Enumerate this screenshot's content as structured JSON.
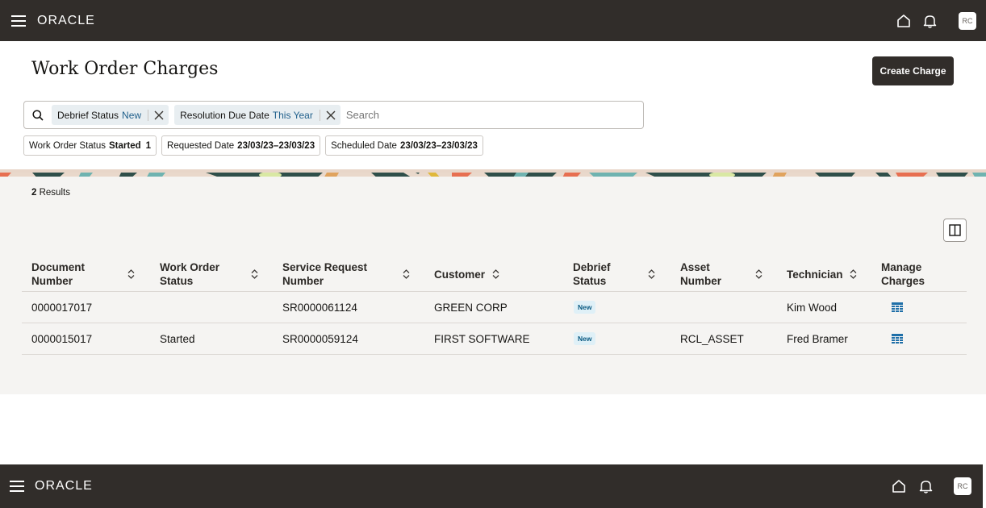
{
  "header": {
    "logo": "ORACLE",
    "avatar": "RC"
  },
  "page": {
    "title": "Work Order Charges",
    "create_button": "Create Charge"
  },
  "search": {
    "placeholder": "Search",
    "chips": [
      {
        "label": "Debrief Status",
        "value": "New"
      },
      {
        "label": "Resolution Due Date",
        "value": "This Year"
      }
    ]
  },
  "filters": [
    {
      "label": "Work Order Status",
      "value": "Started",
      "count": "1"
    },
    {
      "label": "Requested Date",
      "value": "23/03/23–23/03/23"
    },
    {
      "label": "Scheduled Date",
      "value": "23/03/23–23/03/23"
    }
  ],
  "results": {
    "count": "2",
    "label": "Results"
  },
  "table": {
    "columns": [
      {
        "line1": "Document",
        "line2": "Number",
        "sortable": true
      },
      {
        "line1": "Work Order",
        "line2": "Status",
        "sortable": true
      },
      {
        "line1": "Service Request",
        "line2": "Number",
        "sortable": true
      },
      {
        "line1": "Customer",
        "line2": "",
        "sortable": true
      },
      {
        "line1": "Debrief",
        "line2": "Status",
        "sortable": true
      },
      {
        "line1": "Asset",
        "line2": "Number",
        "sortable": true
      },
      {
        "line1": "Technician",
        "line2": "",
        "sortable": true
      },
      {
        "line1": "Manage",
        "line2": "Charges",
        "sortable": false
      }
    ],
    "rows": [
      {
        "document": "0000017017",
        "wo_status": "",
        "sr_number": "SR0000061124",
        "customer": "GREEN CORP",
        "debrief": "New",
        "asset": "",
        "technician": "Kim Wood"
      },
      {
        "document": "0000015017",
        "wo_status": "Started",
        "sr_number": "SR0000059124",
        "customer": "FIRST SOFTWARE",
        "debrief": "New",
        "asset": "RCL_ASSET",
        "technician": "Fred Bramer"
      }
    ]
  },
  "icons": {
    "menu": "hamburger-icon",
    "home": "home-icon",
    "bell": "bell-icon",
    "search": "search-icon",
    "close": "close-icon",
    "sort": "sort-icon",
    "columns": "columns-icon",
    "manage": "grid-table-icon"
  },
  "colors": {
    "topbar": "#312d2a",
    "accent_link": "#1f5f8b",
    "badge_bg": "#dff0f7",
    "content_bg": "#f5f4f2"
  }
}
